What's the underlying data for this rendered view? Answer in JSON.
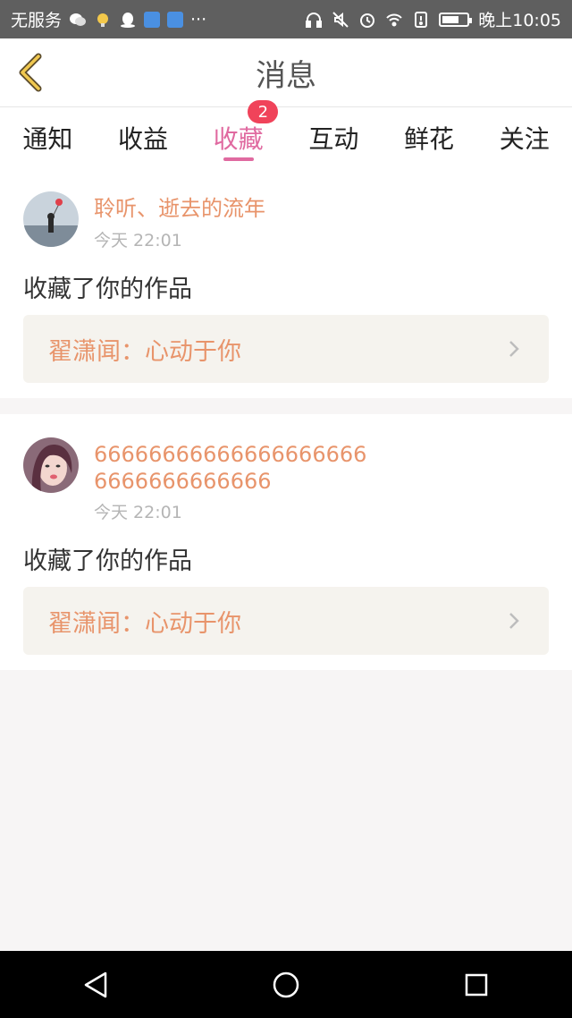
{
  "status_bar": {
    "carrier": "无服务",
    "dots": "···",
    "time": "晚上10:05"
  },
  "header": {
    "title": "消息",
    "back_icon": "chevron-left-icon"
  },
  "tabs": [
    {
      "label": "通知"
    },
    {
      "label": "收益"
    },
    {
      "label": "收藏",
      "badge": "2",
      "active": true
    },
    {
      "label": "互动"
    },
    {
      "label": "鲜花"
    },
    {
      "label": "关注"
    }
  ],
  "messages": [
    {
      "username": "聆听、逝去的流年",
      "time": "今天 22:01",
      "action": "收藏了你的作品",
      "work": "翟潇闻：心动于你"
    },
    {
      "username": "666666666666666666666666666666666",
      "time": "今天 22:01",
      "action": "收藏了你的作品",
      "work": "翟潇闻：心动于你"
    }
  ],
  "colors": {
    "accent": "#e06aa0",
    "username": "#e8946b",
    "badge": "#f0435a"
  }
}
